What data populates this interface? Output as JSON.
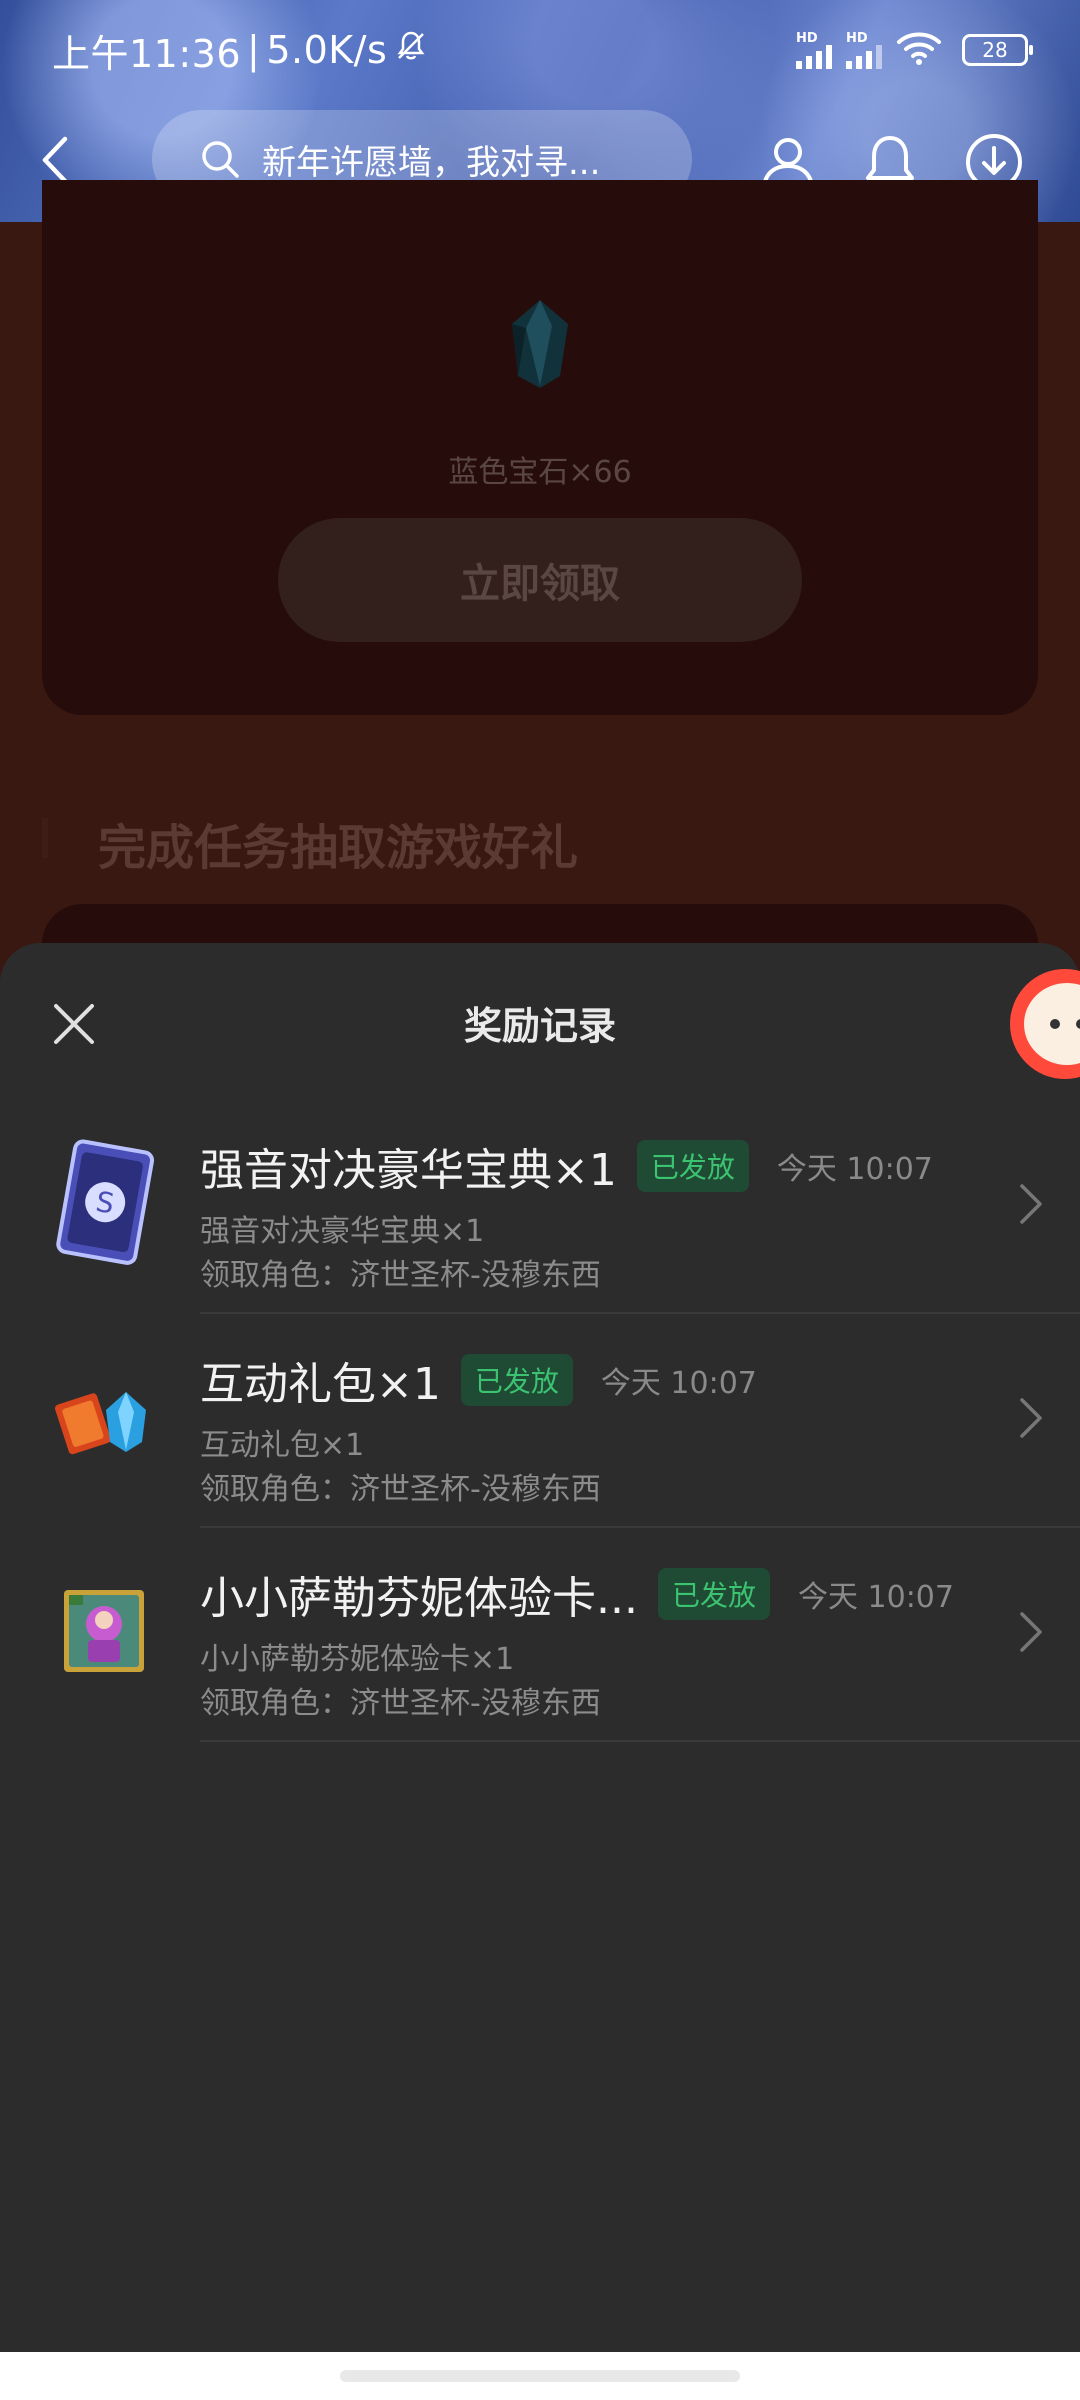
{
  "status_bar": {
    "time": "上午11:36",
    "separator": "|",
    "speed": "5.0K/s",
    "signal1_label": "HD",
    "signal2_label": "HD",
    "battery": "28"
  },
  "nav": {
    "search_placeholder": "新年许愿墙，我对寻..."
  },
  "background": {
    "reward_item": "蓝色宝石×66",
    "claim_button": "立即领取",
    "section_title": "完成任务抽取游戏好礼"
  },
  "sheet": {
    "title": "奖励记录",
    "records": [
      {
        "name": "强音对决豪华宝典×1",
        "status": "已发放",
        "time": "今天 10:07",
        "subtitle": "强音对决豪华宝典×1",
        "role": "领取角色：济世圣杯-没穆东西"
      },
      {
        "name": "互动礼包×1",
        "status": "已发放",
        "time": "今天 10:07",
        "subtitle": "互动礼包×1",
        "role": "领取角色：济世圣杯-没穆东西"
      },
      {
        "name": "小小萨勒芬妮体验卡...",
        "status": "已发放",
        "time": "今天 10:07",
        "subtitle": "小小萨勒芬妮体验卡×1",
        "role": "领取角色：济世圣杯-没穆东西"
      }
    ]
  },
  "colors": {
    "sheet_bg": "#2c2c2c",
    "badge_text": "#3cc372",
    "badge_bg": "#1f4a33",
    "page_bg": "#3a1812"
  },
  "icons": [
    "back-icon",
    "search-icon",
    "user-icon",
    "bell-icon",
    "download-icon",
    "close-icon",
    "chevron-right-icon",
    "mute-bell-icon",
    "wifi-icon"
  ]
}
